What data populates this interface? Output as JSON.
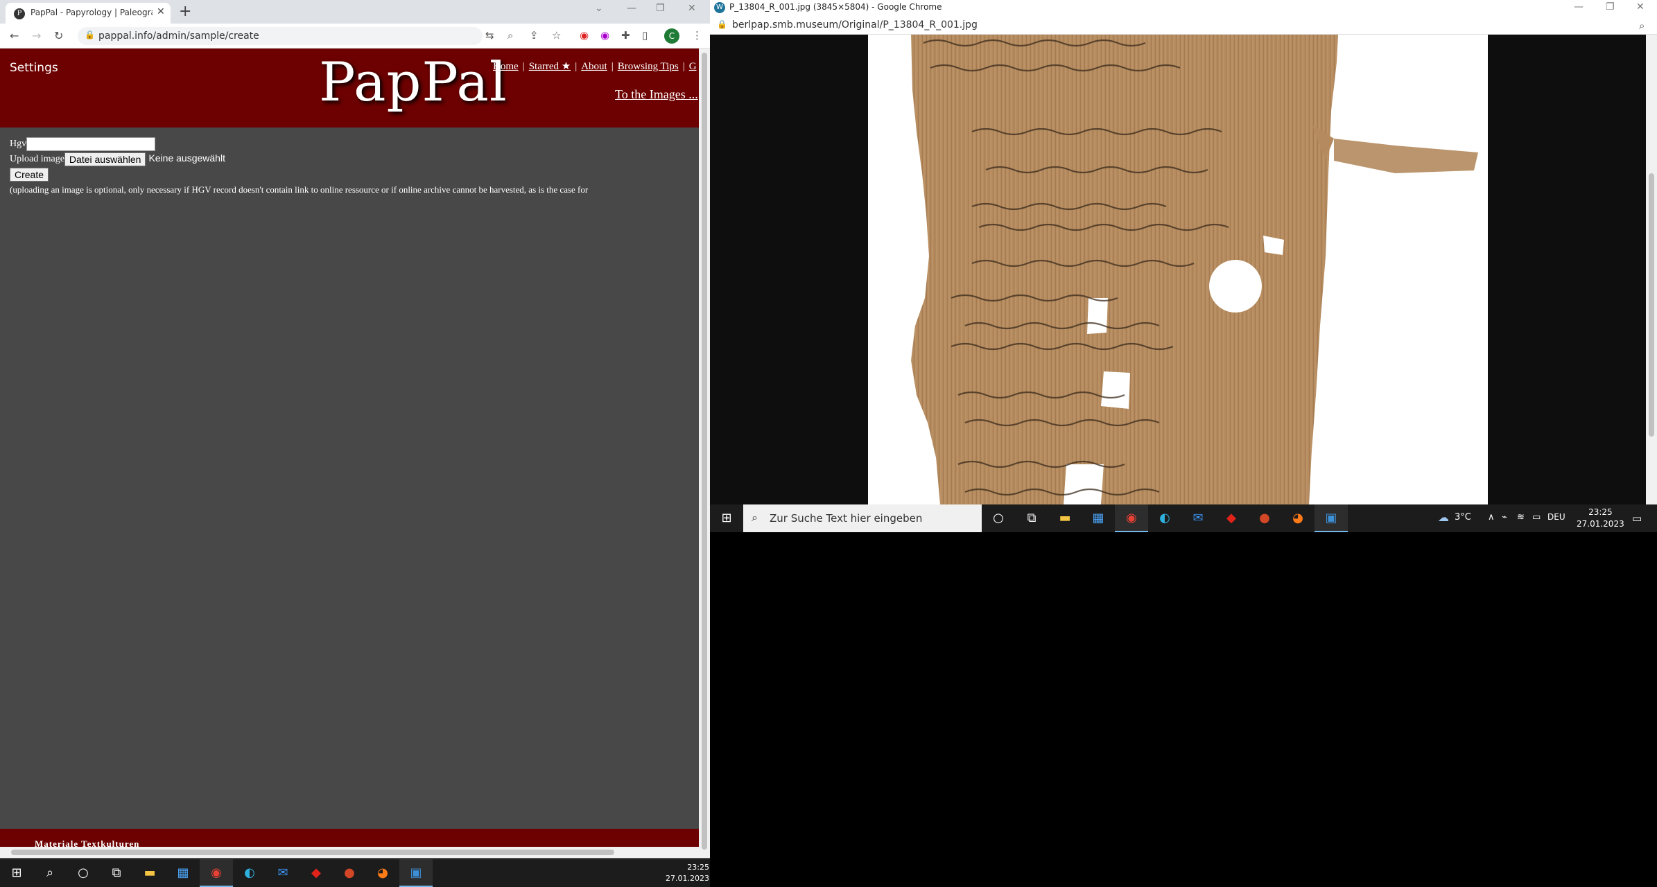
{
  "left_browser": {
    "tab_title": "PapPal - Papyrology | Paleograph",
    "url": "pappal.info/admin/sample/create",
    "profile_initial": "C"
  },
  "site": {
    "settings": "Settings",
    "logo": "PapPal",
    "nav": [
      "Home",
      "Starred ★",
      "About",
      "Browsing Tips"
    ],
    "to_images": "To the Images ...",
    "footer": "Materiale Textkulturen"
  },
  "form": {
    "hgv_label": "Hgv",
    "upload_label": "Upload image",
    "file_button": "Datei auswählen",
    "no_file": "Keine ausgewählt",
    "create": "Create",
    "hint": "(uploading an image is optional, only necessary if HGV record doesn't contain link to online ressource or if online archive cannot be harvested, as is the case for"
  },
  "right_browser": {
    "window_title": "P_13804_R_001.jpg (3845×5804) - Google Chrome",
    "url": "berlpap.smb.museum/Original/P_13804_R_001.jpg"
  },
  "taskbar": {
    "search_placeholder": "Zur Suche Text hier eingeben",
    "weather": "3°C",
    "language": "DEU",
    "time": "23:25",
    "date": "27.01.2023"
  },
  "colors": {
    "header_bg": "#6d0000",
    "page_bg": "#484848",
    "papyrus": "#b48a5e"
  }
}
